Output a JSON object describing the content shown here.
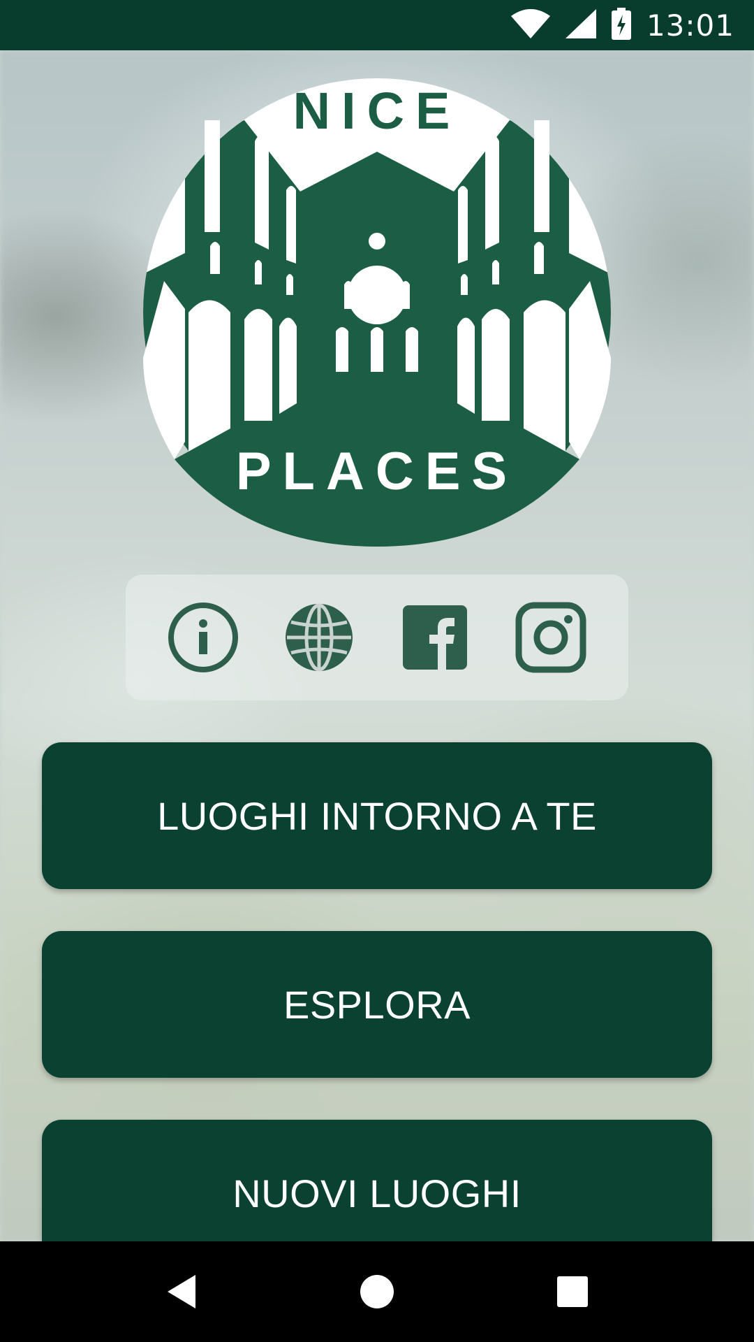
{
  "status_bar": {
    "time": "13:01",
    "icons": [
      "wifi-icon",
      "cell-signal-icon",
      "battery-charging-icon"
    ]
  },
  "logo": {
    "top_text": "NICE",
    "bottom_text": "PLACES",
    "color": "#1b5e45"
  },
  "social": {
    "items": [
      "info-icon",
      "globe-icon",
      "facebook-icon",
      "instagram-icon"
    ],
    "icon_color": "#2e5e4c"
  },
  "menu": {
    "nearby_label": "LUOGHI INTORNO A TE",
    "explore_label": "ESPLORA",
    "new_places_label": "NUOVI LUOGHI"
  },
  "navigation": {
    "items": [
      "back-icon",
      "home-icon",
      "recents-icon"
    ]
  },
  "colors": {
    "primary": "#0a4131",
    "status_bar": "#083d2e",
    "nav_bar": "#000000"
  }
}
